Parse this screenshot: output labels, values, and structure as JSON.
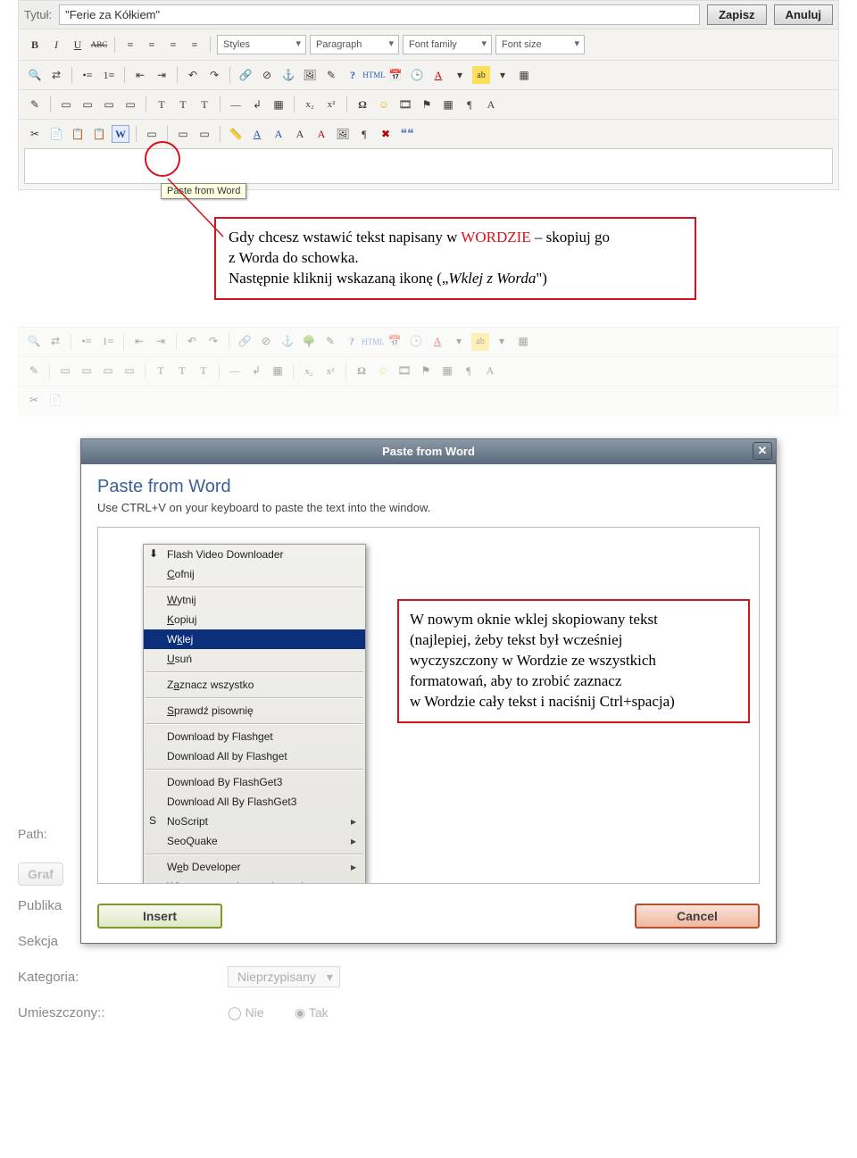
{
  "top": {
    "title_label": "Tytuł:",
    "title_value": "\"Ferie za Kółkiem\"",
    "save_label": "Zapisz",
    "cancel_label": "Anuluj",
    "select_styles": "Styles",
    "select_paragraph": "Paragraph",
    "select_fontfamily": "Font family",
    "select_fontsize": "Font size",
    "tooltip_paste_word": "Paste from Word"
  },
  "icons": {
    "bold": "B",
    "italic": "I",
    "underline": "U",
    "strike": "ABC",
    "align_l": "≡",
    "align_c": "≡",
    "align_r": "≡",
    "align_j": "≡",
    "find": "🔍",
    "replace": "⇄",
    "ul": "•≡",
    "ol": "1≡",
    "outdent": "⇤",
    "indent": "⇥",
    "undo": "↶",
    "redo": "↷",
    "link": "🔗",
    "unlink": "⊘",
    "anchor": "⚓",
    "image": "🖼",
    "clean": "✎",
    "help": "?",
    "html": "HTML",
    "date": "📅",
    "clock": "🕒",
    "color": "A",
    "bg": "ab",
    "table": "▦",
    "pencil": "✎",
    "layer1": "▭",
    "layer2": "▭",
    "abs": "▭",
    "layer4": "▭",
    "t1": "T",
    "t2": "T",
    "t3": "T",
    "hr": "—",
    "smile": "☺",
    "media": "🎞",
    "flag1": "⚑",
    "flag2": "▦",
    "pilcrow": "¶",
    "ahigh": "A",
    "pilcrow2": "¶",
    "cut": "✂",
    "copy": "📄",
    "paste": "📋",
    "paste_plain": "📋",
    "paste_word": "W",
    "sel": "▭",
    "box1": "▭",
    "box2": "▭",
    "ruler": "📏",
    "aa1": "A",
    "aa2": "A",
    "aa3": "A",
    "aa4": "A",
    "pic": "🖼",
    "omega": "Ω",
    "x": "✖",
    "quote": "❝❝",
    "sub": "x₂",
    "sup": "x²",
    "tree": "🌳",
    "brk": "↲"
  },
  "callouts": {
    "c1_line1_pre": "Gdy chcesz wstawić tekst napisany w ",
    "c1_line1_em": "WORDZIE",
    "c1_line1_post": " – skopiuj go",
    "c1_line2": "z Worda do schowka.",
    "c1_line3_pre": "Następnie kliknij wskazaną ikonę („",
    "c1_line3_it": "Wklej z Worda",
    "c1_line3_post": "\")",
    "c2_l1": "W nowym oknie wklej skopiowany tekst",
    "c2_l2": "(najlepiej, żeby tekst był wcześniej",
    "c2_l3": "wyczyszczony w Wordzie ze wszystkich",
    "c2_l4": "formatowań, aby to zrobić zaznacz",
    "c2_l5": "w Wordzie cały tekst i naciśnij Ctrl+spacja)"
  },
  "dialog": {
    "header": "Paste from Word",
    "title": "Paste from Word",
    "subtitle": "Use CTRL+V on your keyboard to paste the text into the window.",
    "insert": "Insert",
    "cancel": "Cancel"
  },
  "context_menu": {
    "items": [
      {
        "label": "Flash Video Downloader",
        "icon": "⬇"
      },
      {
        "label": "Cofnij",
        "ul": "C"
      },
      {
        "sep": true
      },
      {
        "label": "Wytnij",
        "ul": "W"
      },
      {
        "label": "Kopiuj",
        "ul": "K"
      },
      {
        "label": "Wklej",
        "ul": "k",
        "sel": true
      },
      {
        "label": "Usuń",
        "ul": "U"
      },
      {
        "sep": true
      },
      {
        "label": "Zaznacz wszystko",
        "ul": "a"
      },
      {
        "sep": true
      },
      {
        "label": "Sprawdź pisownię",
        "ul": "S"
      },
      {
        "sep": true
      },
      {
        "label": "Download by Flashget"
      },
      {
        "label": "Download All by Flashget"
      },
      {
        "sep": true
      },
      {
        "label": "Download By FlashGet3"
      },
      {
        "label": "Download All By FlashGet3"
      },
      {
        "label": "NoScript",
        "icon": "S",
        "arrow": true
      },
      {
        "label": "SeoQuake",
        "arrow": true
      },
      {
        "sep": true
      },
      {
        "label": "Web Developer",
        "ul": "e",
        "arrow": true
      },
      {
        "label": "Włącz ponownie na tej stronie"
      }
    ]
  },
  "bottom_form": {
    "path": "Path:",
    "graf": "Graf",
    "publika": "Publika",
    "sekcja": "Sekcja",
    "kategoria": "Kategoria:",
    "kat_value": "Nieprzypisany",
    "umieszczony": "Umieszczony::",
    "nie": "Nie",
    "tak": "Tak"
  }
}
